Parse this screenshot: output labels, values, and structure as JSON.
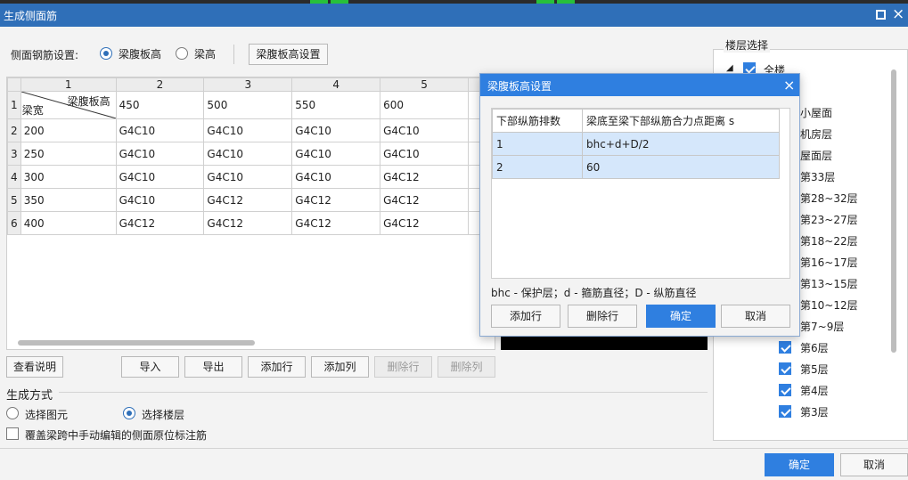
{
  "window": {
    "title": "生成侧面筋"
  },
  "rebar_setting": {
    "label": "侧面钢筋设置:",
    "options": [
      "梁腹板高",
      "梁高"
    ],
    "selected": "梁腹板高",
    "settings_button": "梁腹板高设置"
  },
  "grid": {
    "col_headers": [
      "1",
      "2",
      "3",
      "4",
      "5"
    ],
    "corner": {
      "top_right": "梁腹板高",
      "bottom_left": "梁宽"
    },
    "header_values": [
      "450",
      "500",
      "550",
      "600"
    ],
    "rows": [
      {
        "num": "2",
        "width": "200",
        "cells": [
          "G4C10",
          "G4C10",
          "G4C10",
          "G4C10"
        ]
      },
      {
        "num": "3",
        "width": "250",
        "cells": [
          "G4C10",
          "G4C10",
          "G4C10",
          "G4C10"
        ]
      },
      {
        "num": "4",
        "width": "300",
        "cells": [
          "G4C10",
          "G4C10",
          "G4C10",
          "G4C12"
        ]
      },
      {
        "num": "5",
        "width": "350",
        "cells": [
          "G4C10",
          "G4C12",
          "G4C12",
          "G4C12"
        ]
      },
      {
        "num": "6",
        "width": "400",
        "cells": [
          "G4C12",
          "G4C12",
          "G4C12",
          "G4C12"
        ]
      }
    ],
    "first_row_num": "1"
  },
  "toolbar": {
    "view_help": "查看说明",
    "import": "导入",
    "export": "导出",
    "add_row": "添加行",
    "add_col": "添加列",
    "del_row": "删除行",
    "del_col": "删除列"
  },
  "generate": {
    "title": "生成方式",
    "options": [
      "选择图元",
      "选择楼层"
    ],
    "selected": "选择楼层",
    "overwrite": "覆盖梁跨中手动编辑的侧面原位标注筋"
  },
  "floors": {
    "title": "楼层选择",
    "all": "全楼",
    "items": [
      {
        "name": "小屋面",
        "checked": true
      },
      {
        "name": "机房层",
        "checked": true
      },
      {
        "name": "屋面层",
        "checked": true
      },
      {
        "name": "第33层",
        "checked": true
      },
      {
        "name": "第28~32层",
        "checked": true
      },
      {
        "name": "第23~27层",
        "checked": true
      },
      {
        "name": "第18~22层",
        "checked": true
      },
      {
        "name": "第16~17层",
        "checked": true
      },
      {
        "name": "第13~15层",
        "checked": true
      },
      {
        "name": "第10~12层",
        "checked": true
      },
      {
        "name": "第7~9层",
        "checked": true
      },
      {
        "name": "第6层",
        "checked": true
      },
      {
        "name": "第5层",
        "checked": true
      },
      {
        "name": "第4层",
        "checked": true
      },
      {
        "name": "第3层",
        "checked": true
      }
    ]
  },
  "footer": {
    "ok": "确定",
    "cancel": "取消"
  },
  "popup": {
    "title": "梁腹板高设置",
    "headers": [
      "下部纵筋排数",
      "梁底至梁下部纵筋合力点距离 s"
    ],
    "rows": [
      {
        "count": "1",
        "distance": "bhc+d+D/2"
      },
      {
        "count": "2",
        "distance": "60"
      }
    ],
    "legend": "bhc - 保护层；d - 箍筋直径；D - 纵筋直径",
    "add_row": "添加行",
    "del_row": "删除行",
    "ok": "确定",
    "cancel": "取消"
  },
  "colors": {
    "title_blue": "#2f6fb8",
    "accent": "#2f7fe0"
  }
}
